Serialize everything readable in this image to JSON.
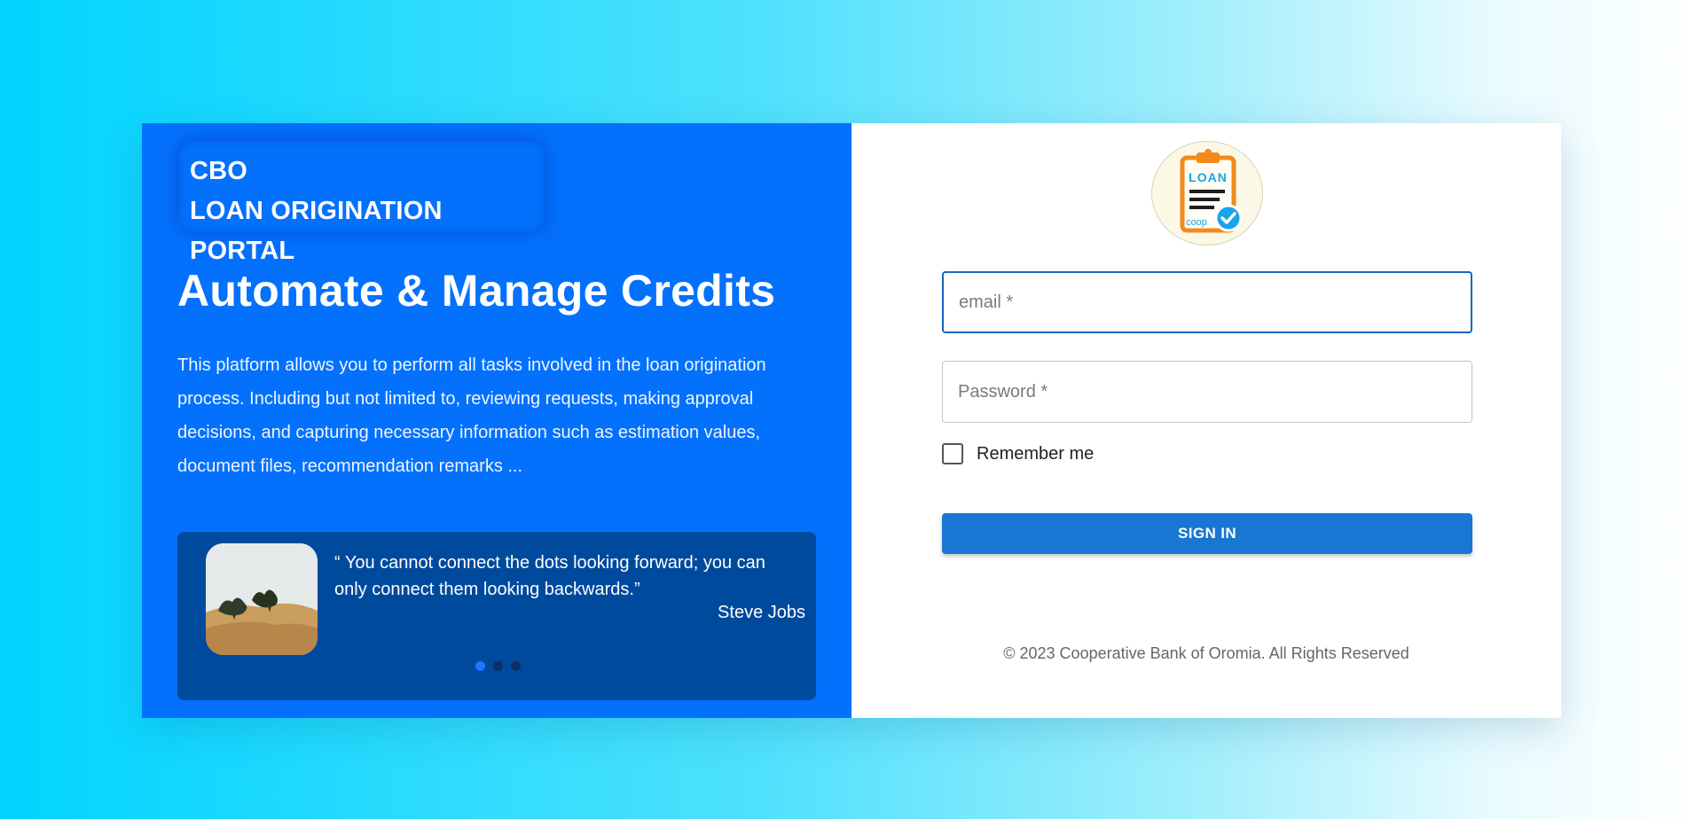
{
  "brand": {
    "line1": "CBO",
    "line2": "LOAN ORIGINATION PORTAL"
  },
  "headline": "Automate & Manage Credits",
  "description": "This platform allows you to perform all tasks involved in the loan origination process. Including but not limited to, reviewing requests, making approval decisions, and capturing necessary information such as estimation values, document files, recommendation remarks ...",
  "quote": {
    "text": "“ You cannot connect the dots looking forward; you can only connect them looking backwards.”",
    "author": "Steve Jobs",
    "dots": 3,
    "active_dot": 1
  },
  "logo": {
    "icon": "loan-clipboard-icon",
    "label": "LOAN",
    "sublabel": "coop"
  },
  "form": {
    "email_placeholder": "email *",
    "password_placeholder": "Password *",
    "remember_label": "Remember me",
    "signin_label": "SIGN IN"
  },
  "footer": "© 2023 Cooperative Bank of Oromia. All Rights Reserved",
  "colors": {
    "left_panel": "#0471fd",
    "quote_card": "#004a9d",
    "primary_button": "#1976d2",
    "focus_border": "#1565c0",
    "background_start": "#00d4ff",
    "background_end": "#ffffff"
  }
}
